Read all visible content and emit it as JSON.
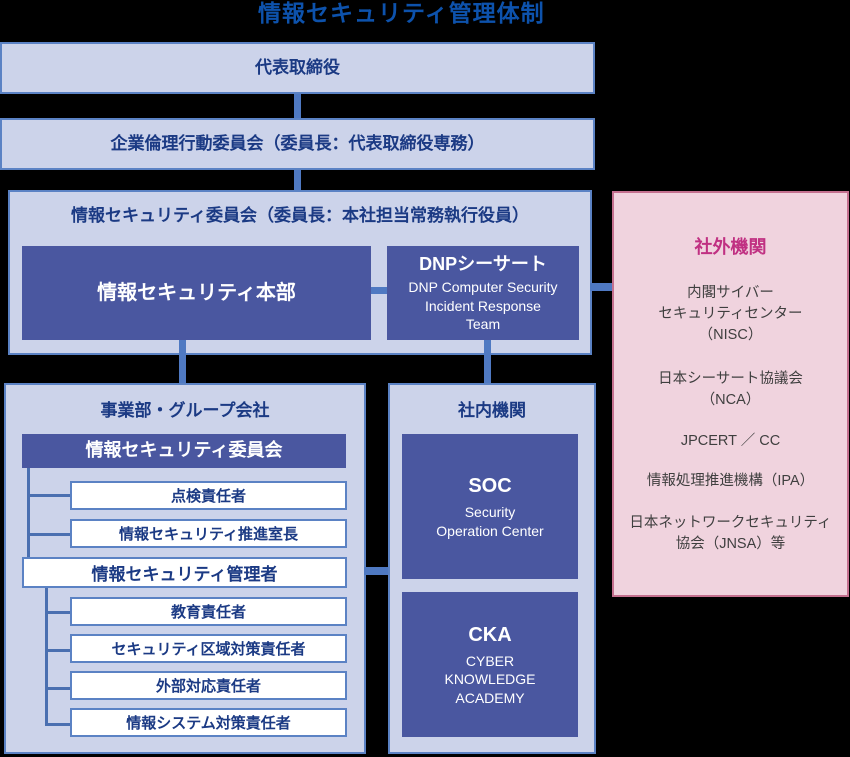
{
  "title": "情報セキュリティ管理体制",
  "top_boxes": [
    {
      "label": "代表取締役"
    },
    {
      "label": "企業倫理行動委員会（委員長：代表取締役専務）"
    }
  ],
  "committee_panel": {
    "title": "情報セキュリティ委員会（委員長：本社担当常務執行役員）",
    "hq_box": {
      "label": "情報セキュリティ本部"
    },
    "csirt_box": {
      "title": "DNPシーサート",
      "subtitle": "DNP Computer Security\nIncident Response\nTeam"
    }
  },
  "division_panel": {
    "title": "事業部・グループ会社",
    "committee": {
      "label": "情報セキュリティ委員会"
    },
    "committee_children": [
      {
        "label": "点検責任者"
      },
      {
        "label": "情報セキュリティ推進室長"
      }
    ],
    "manager": {
      "label": "情報セキュリティ管理者"
    },
    "manager_children": [
      {
        "label": "教育責任者"
      },
      {
        "label": "セキュリティ区域対策責任者"
      },
      {
        "label": "外部対応責任者"
      },
      {
        "label": "情報システム対策責任者"
      }
    ]
  },
  "internal_panel": {
    "title": "社内機関",
    "boxes": [
      {
        "title": "SOC",
        "subtitle": "Security\nOperation Center"
      },
      {
        "title": "CKA",
        "subtitle": "CYBER\nKNOWLEDGE\nACADEMY"
      }
    ]
  },
  "external_panel": {
    "title": "社外機関",
    "items": [
      "内閣サイバー\nセキュリティセンター\n（NISC）",
      "日本シーサート協議会\n（NCA）",
      "JPCERT ／ CC",
      "情報処理推進機構（IPA）",
      "日本ネットワークセキュリティ\n協会（JNSA）等"
    ]
  },
  "colors": {
    "title_blue": "#0d52ac",
    "box_fill_light": "#ccd3ea",
    "box_border": "#5b82c4",
    "box_fill_dark": "#4a57a0",
    "text_blue": "#1b3a84",
    "pink_fill": "#f0d3de",
    "pink_border": "#c4708f",
    "pink_title": "#c03082",
    "connector": "#4f79c2",
    "background": "#000000"
  }
}
